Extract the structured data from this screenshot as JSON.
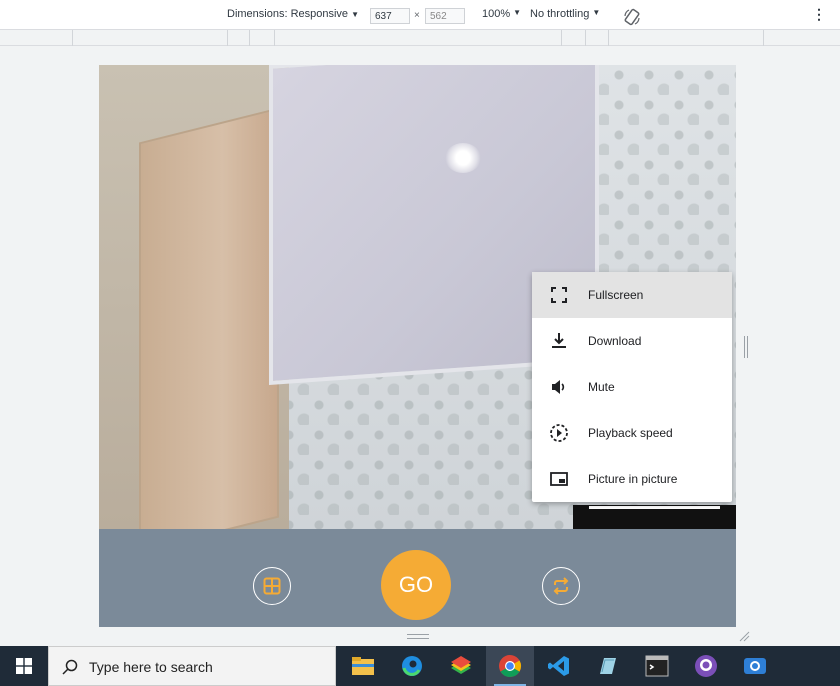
{
  "devtools": {
    "dimensions_label": "Dimensions: Responsive",
    "width_value": "637",
    "height_value": "562",
    "times": "×",
    "zoom": "100%",
    "throttling": "No throttling",
    "caret": "▼",
    "more": "⋮"
  },
  "menu": {
    "items": [
      {
        "label": "Fullscreen",
        "icon": "fullscreen-icon"
      },
      {
        "label": "Download",
        "icon": "download-icon"
      },
      {
        "label": "Mute",
        "icon": "volume-icon"
      },
      {
        "label": "Playback speed",
        "icon": "playback-speed-icon"
      },
      {
        "label": "Picture in picture",
        "icon": "picture-in-picture-icon"
      }
    ]
  },
  "controls": {
    "go_label": "GO",
    "left_icon": "grid-icon",
    "right_icon": "switch-camera-icon",
    "accent": "#f5ab35",
    "bar_color": "#7b8a99"
  },
  "taskbar": {
    "search_placeholder": "Type here to search",
    "apps": [
      "file-explorer",
      "edge",
      "bluestacks",
      "chrome",
      "vscode",
      "notepad-tool",
      "terminal",
      "github-desktop",
      "screen-capture"
    ]
  }
}
